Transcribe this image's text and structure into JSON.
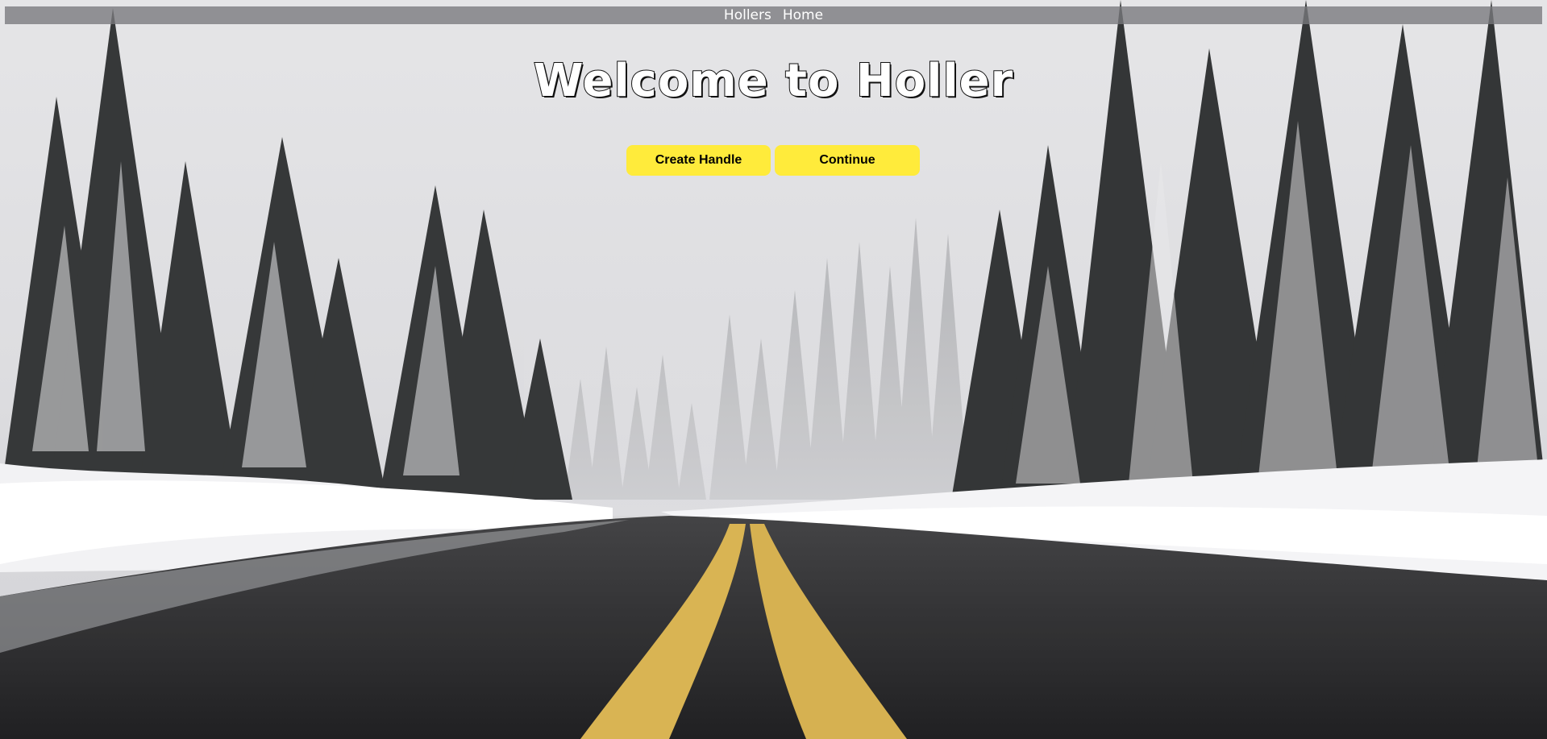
{
  "nav": {
    "links": [
      {
        "label": "Hollers"
      },
      {
        "label": "Home"
      }
    ]
  },
  "hero": {
    "title": "Welcome to Holler",
    "background_image": "snowy-forest-road-photo"
  },
  "actions": {
    "create_handle_label": "Create Handle",
    "continue_label": "Continue",
    "button_color": "#ffeb3b"
  }
}
